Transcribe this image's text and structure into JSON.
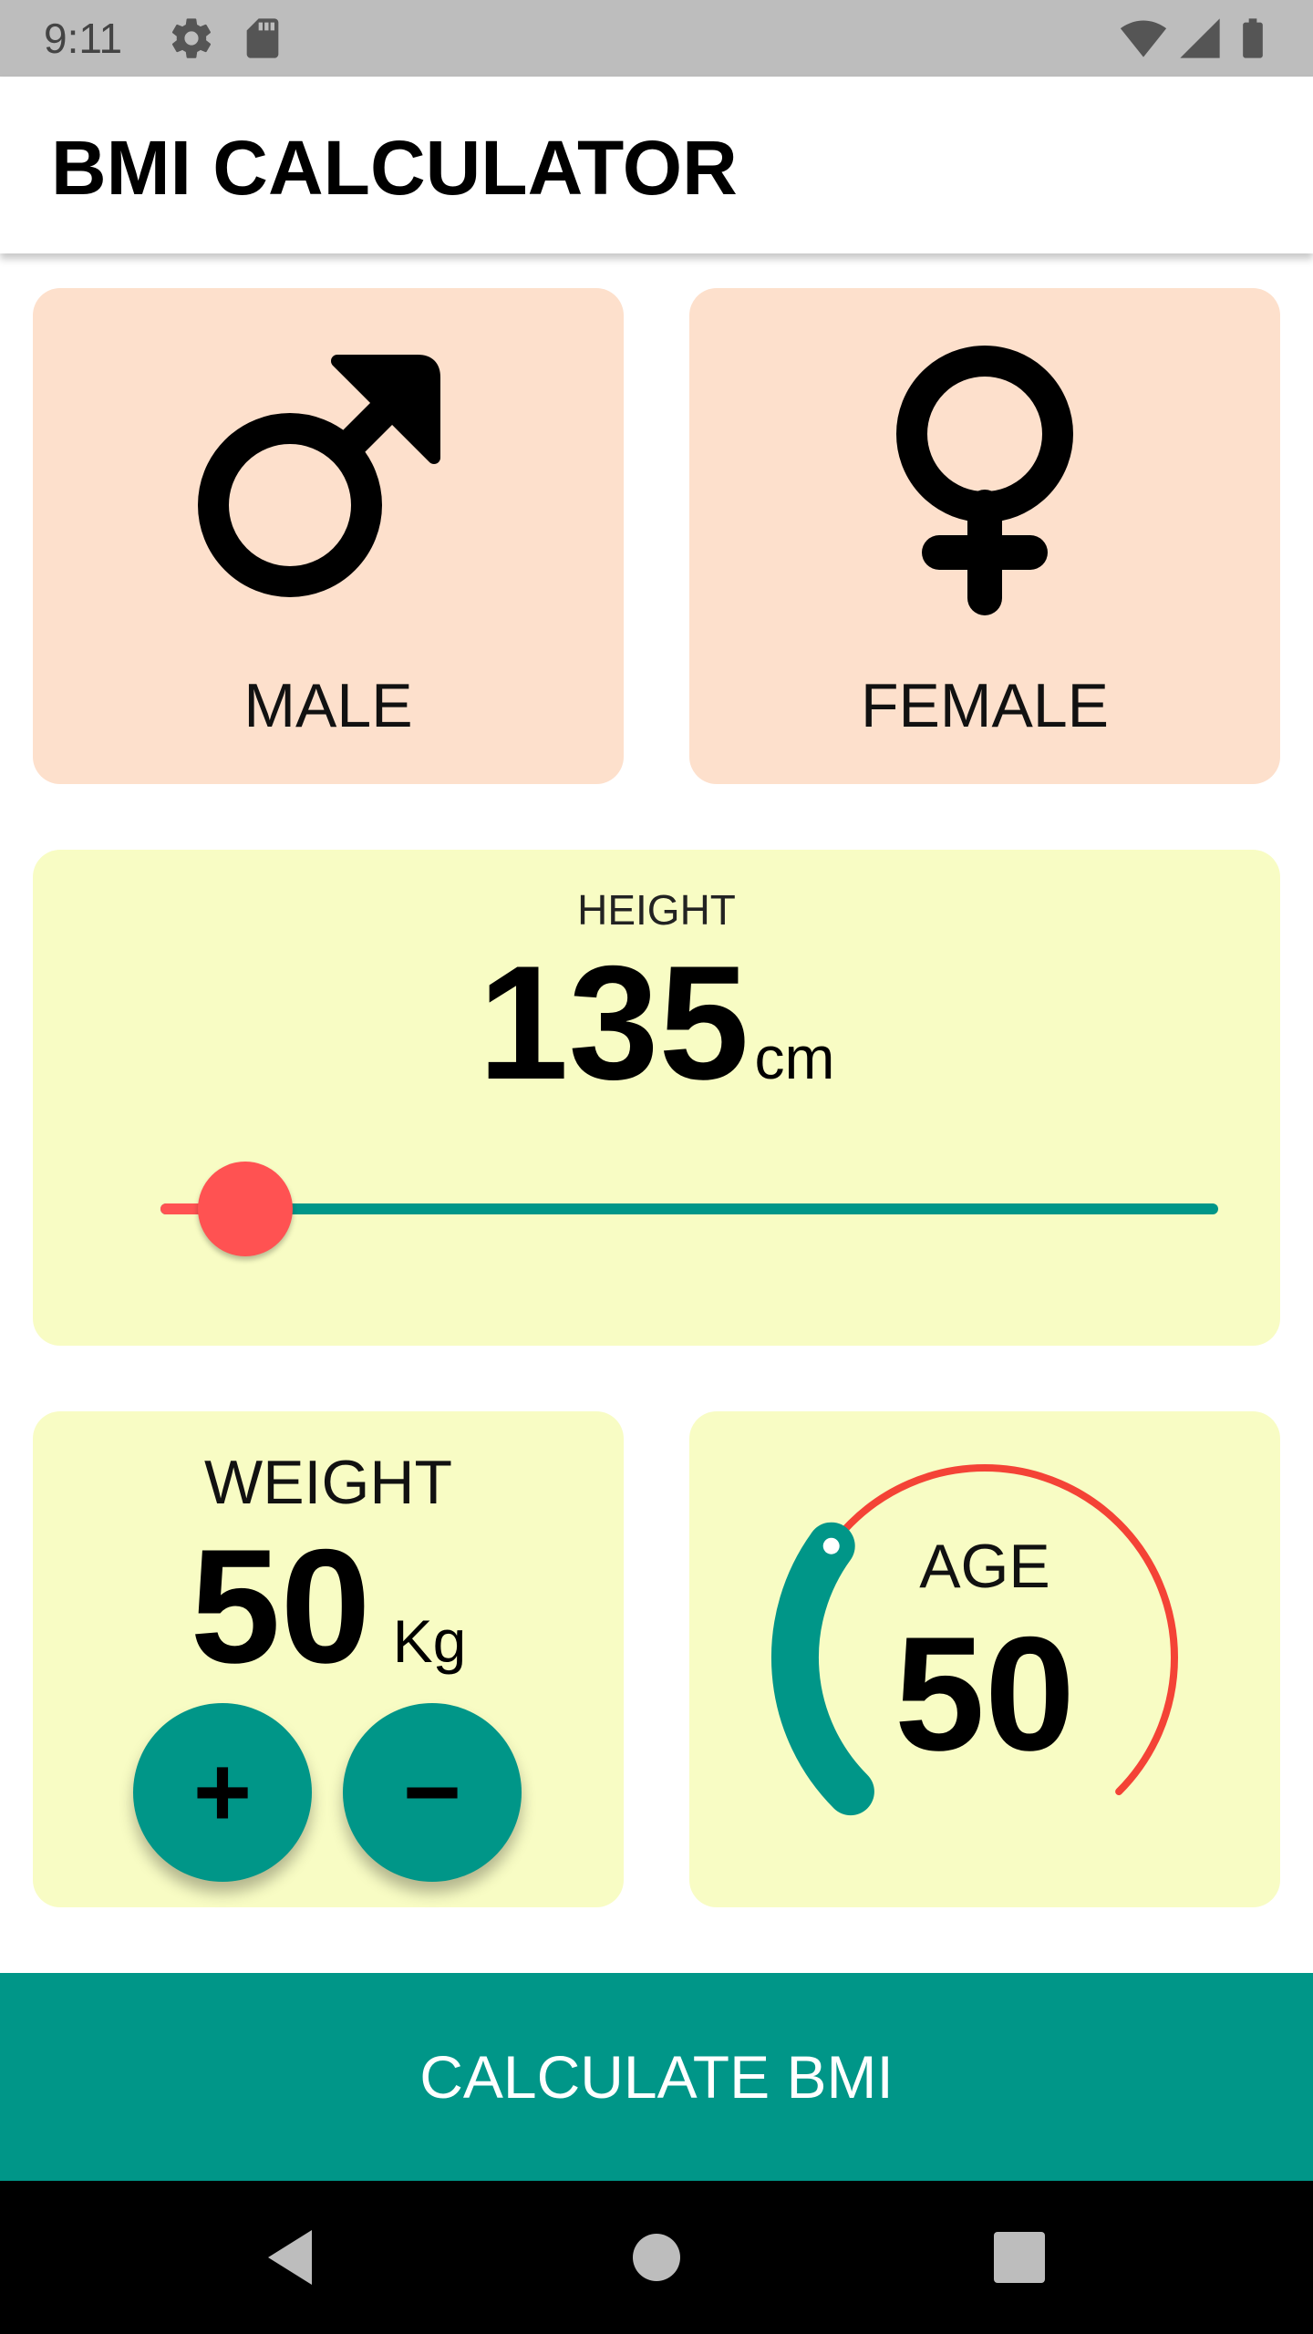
{
  "status_bar": {
    "time": "9:11",
    "icons_left": [
      "settings-icon",
      "sd-card-icon"
    ],
    "icons_right": [
      "wifi-icon",
      "cell-signal-icon",
      "battery-icon"
    ]
  },
  "app_bar": {
    "title": "BMI CALCULATOR"
  },
  "gender": {
    "male": {
      "label": "MALE",
      "icon": "male-symbol-icon"
    },
    "female": {
      "label": "FEMALE",
      "icon": "female-symbol-icon"
    }
  },
  "height": {
    "label": "HEIGHT",
    "value": "135",
    "unit": "cm",
    "slider_fraction": 0.08
  },
  "weight": {
    "label": "WEIGHT",
    "value": "50",
    "unit": "Kg",
    "increment_symbol": "+",
    "decrement_symbol": "−"
  },
  "age": {
    "label": "AGE",
    "value": "50",
    "dial_fraction": 0.3
  },
  "calculate_button": {
    "label": "CALCULATE BMI"
  },
  "nav_bar": {
    "buttons": [
      "back-icon",
      "home-icon",
      "recents-icon"
    ]
  },
  "colors": {
    "accent": "#009688",
    "highlight": "#ff5252",
    "gender_card": "#fde0cc",
    "info_card": "#f8fcc4",
    "status_bar": "#bdbdbd"
  }
}
